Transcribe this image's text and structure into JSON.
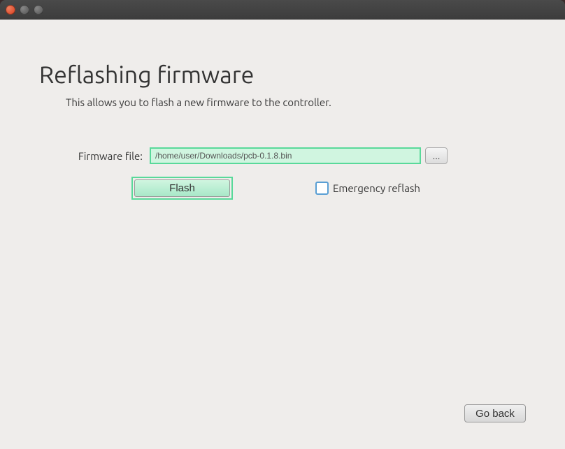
{
  "titlebar": {
    "close": "×",
    "min": "−",
    "max": "□"
  },
  "page": {
    "title": "Reflashing firmware",
    "subtitle": "This allows you to flash a new firmware to the controller."
  },
  "form": {
    "file_label": "Firmware file:",
    "file_value": "/home/user/Downloads/pcb-0.1.8.bin",
    "browse_label": "...",
    "flash_label": "Flash",
    "emergency_label": "Emergency reflash",
    "emergency_checked": false
  },
  "footer": {
    "goback_label": "Go back"
  }
}
